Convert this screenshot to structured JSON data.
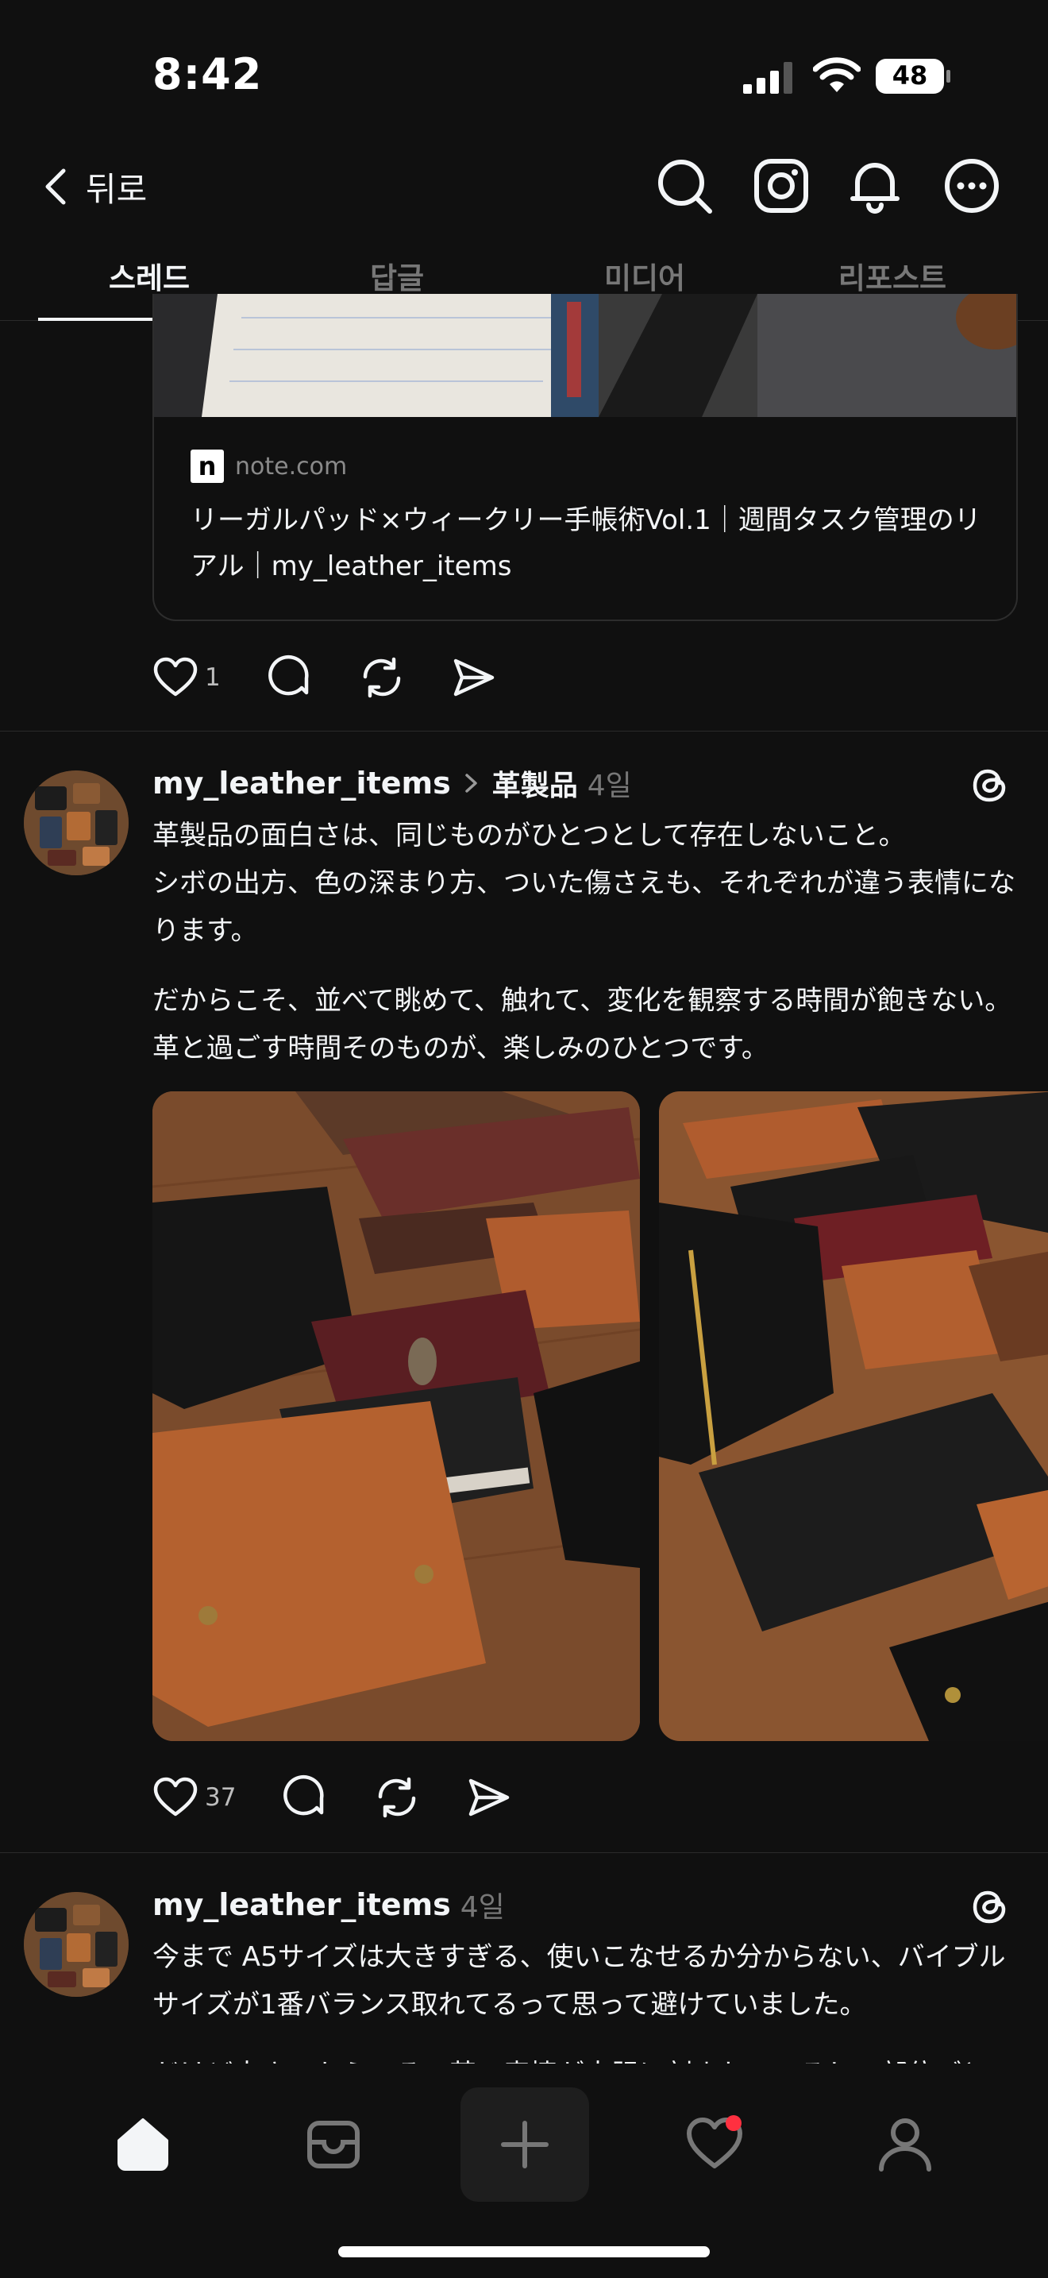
{
  "status_bar": {
    "time": "8:42",
    "battery": "48"
  },
  "header": {
    "back_label": "뒤로"
  },
  "tabs": [
    {
      "label": "스레드",
      "active": true
    },
    {
      "label": "답글",
      "active": false
    },
    {
      "label": "미디어",
      "active": false
    },
    {
      "label": "리포스트",
      "active": false
    }
  ],
  "prev_post": {
    "link_card": {
      "logo_letter": "n",
      "domain": "note.com",
      "title": "リーガルパッド×ウィークリー手帳術Vol.1｜週間タスク管理のリアル｜my_leather_items"
    },
    "likes": "1"
  },
  "post1": {
    "username": "my_leather_items",
    "topic": "革製品",
    "time": "4일",
    "paragraphs": [
      "革製品の面白さは、同じものがひとつとして存在しないこと。\nシボの出方、色の深まり方、ついた傷さえも、それぞれが違う表情になります。",
      "だからこそ、並べて眺めて、触れて、変化を観察する時間が飽きない。\n革と過ごす時間そのものが、楽しみのひとつです。"
    ],
    "likes": "37"
  },
  "post2": {
    "username": "my_leather_items",
    "time": "4일",
    "paragraphs": [
      "今まで A5サイズは大きすぎる、使いこなせるか分からない、バイブルサイズが1番バランス取れてるって思って避けていました。",
      "だけど大きいからこそ、革の表情が大胆に刻まれているし、部位ごとの"
    ]
  },
  "icons": {
    "header": [
      "back-icon",
      "search-icon",
      "instagram-icon",
      "bell-icon",
      "more-icon"
    ],
    "actions": [
      "heart-icon",
      "comment-icon",
      "repost-icon",
      "share-icon"
    ],
    "nav": [
      "home-icon",
      "inbox-icon",
      "plus-icon",
      "activity-heart-icon",
      "profile-icon"
    ]
  },
  "colors": {
    "background": "#101010",
    "text": "#f3f5f7",
    "muted": "#777777",
    "notification_dot": "#ff3040"
  }
}
